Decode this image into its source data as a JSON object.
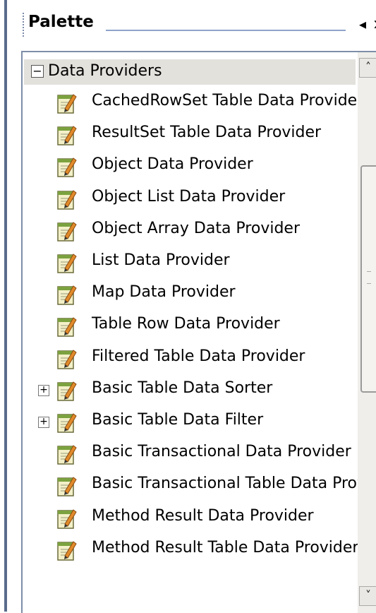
{
  "palette": {
    "title": "Palette",
    "minimize_icon": "◂",
    "close_icon": "×"
  },
  "category": {
    "label": "Data Providers",
    "toggle": "−"
  },
  "items": [
    {
      "label": "CachedRowSet Table Data Provider",
      "expandable": false
    },
    {
      "label": "ResultSet Table Data Provider",
      "expandable": false
    },
    {
      "label": "Object Data Provider",
      "expandable": false
    },
    {
      "label": "Object List Data Provider",
      "expandable": false
    },
    {
      "label": "Object Array Data Provider",
      "expandable": false
    },
    {
      "label": "List Data Provider",
      "expandable": false
    },
    {
      "label": "Map Data Provider",
      "expandable": false
    },
    {
      "label": "Table Row Data Provider",
      "expandable": false
    },
    {
      "label": "Filtered Table Data Provider",
      "expandable": false
    },
    {
      "label": "Basic Table Data Sorter",
      "expandable": true
    },
    {
      "label": "Basic Table Data Filter",
      "expandable": true
    },
    {
      "label": "Basic Transactional Data Provider",
      "expandable": false
    },
    {
      "label": "Basic Transactional Table Data Provid",
      "expandable": false
    },
    {
      "label": "Method Result Data Provider",
      "expandable": false
    },
    {
      "label": "Method Result Table Data Provider",
      "expandable": false
    }
  ],
  "item_icon": "edit-pencil-icon",
  "expand_glyph": "+",
  "scrollbar": {
    "up": "˄",
    "down": "˅"
  }
}
